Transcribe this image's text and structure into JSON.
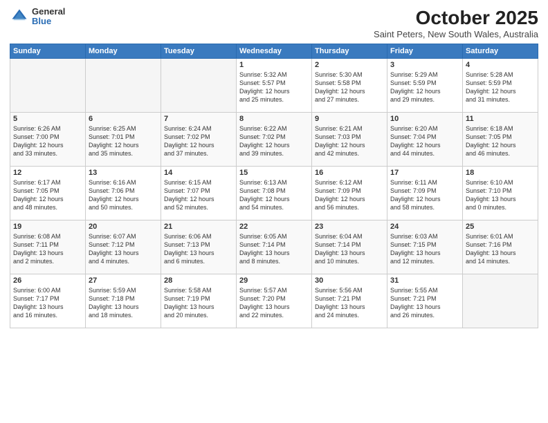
{
  "logo": {
    "general": "General",
    "blue": "Blue"
  },
  "header": {
    "month": "October 2025",
    "location": "Saint Peters, New South Wales, Australia"
  },
  "days_of_week": [
    "Sunday",
    "Monday",
    "Tuesday",
    "Wednesday",
    "Thursday",
    "Friday",
    "Saturday"
  ],
  "weeks": [
    [
      {
        "day": "",
        "content": ""
      },
      {
        "day": "",
        "content": ""
      },
      {
        "day": "",
        "content": ""
      },
      {
        "day": "1",
        "content": "Sunrise: 5:32 AM\nSunset: 5:57 PM\nDaylight: 12 hours\nand 25 minutes."
      },
      {
        "day": "2",
        "content": "Sunrise: 5:30 AM\nSunset: 5:58 PM\nDaylight: 12 hours\nand 27 minutes."
      },
      {
        "day": "3",
        "content": "Sunrise: 5:29 AM\nSunset: 5:59 PM\nDaylight: 12 hours\nand 29 minutes."
      },
      {
        "day": "4",
        "content": "Sunrise: 5:28 AM\nSunset: 5:59 PM\nDaylight: 12 hours\nand 31 minutes."
      }
    ],
    [
      {
        "day": "5",
        "content": "Sunrise: 6:26 AM\nSunset: 7:00 PM\nDaylight: 12 hours\nand 33 minutes."
      },
      {
        "day": "6",
        "content": "Sunrise: 6:25 AM\nSunset: 7:01 PM\nDaylight: 12 hours\nand 35 minutes."
      },
      {
        "day": "7",
        "content": "Sunrise: 6:24 AM\nSunset: 7:02 PM\nDaylight: 12 hours\nand 37 minutes."
      },
      {
        "day": "8",
        "content": "Sunrise: 6:22 AM\nSunset: 7:02 PM\nDaylight: 12 hours\nand 39 minutes."
      },
      {
        "day": "9",
        "content": "Sunrise: 6:21 AM\nSunset: 7:03 PM\nDaylight: 12 hours\nand 42 minutes."
      },
      {
        "day": "10",
        "content": "Sunrise: 6:20 AM\nSunset: 7:04 PM\nDaylight: 12 hours\nand 44 minutes."
      },
      {
        "day": "11",
        "content": "Sunrise: 6:18 AM\nSunset: 7:05 PM\nDaylight: 12 hours\nand 46 minutes."
      }
    ],
    [
      {
        "day": "12",
        "content": "Sunrise: 6:17 AM\nSunset: 7:05 PM\nDaylight: 12 hours\nand 48 minutes."
      },
      {
        "day": "13",
        "content": "Sunrise: 6:16 AM\nSunset: 7:06 PM\nDaylight: 12 hours\nand 50 minutes."
      },
      {
        "day": "14",
        "content": "Sunrise: 6:15 AM\nSunset: 7:07 PM\nDaylight: 12 hours\nand 52 minutes."
      },
      {
        "day": "15",
        "content": "Sunrise: 6:13 AM\nSunset: 7:08 PM\nDaylight: 12 hours\nand 54 minutes."
      },
      {
        "day": "16",
        "content": "Sunrise: 6:12 AM\nSunset: 7:09 PM\nDaylight: 12 hours\nand 56 minutes."
      },
      {
        "day": "17",
        "content": "Sunrise: 6:11 AM\nSunset: 7:09 PM\nDaylight: 12 hours\nand 58 minutes."
      },
      {
        "day": "18",
        "content": "Sunrise: 6:10 AM\nSunset: 7:10 PM\nDaylight: 13 hours\nand 0 minutes."
      }
    ],
    [
      {
        "day": "19",
        "content": "Sunrise: 6:08 AM\nSunset: 7:11 PM\nDaylight: 13 hours\nand 2 minutes."
      },
      {
        "day": "20",
        "content": "Sunrise: 6:07 AM\nSunset: 7:12 PM\nDaylight: 13 hours\nand 4 minutes."
      },
      {
        "day": "21",
        "content": "Sunrise: 6:06 AM\nSunset: 7:13 PM\nDaylight: 13 hours\nand 6 minutes."
      },
      {
        "day": "22",
        "content": "Sunrise: 6:05 AM\nSunset: 7:14 PM\nDaylight: 13 hours\nand 8 minutes."
      },
      {
        "day": "23",
        "content": "Sunrise: 6:04 AM\nSunset: 7:14 PM\nDaylight: 13 hours\nand 10 minutes."
      },
      {
        "day": "24",
        "content": "Sunrise: 6:03 AM\nSunset: 7:15 PM\nDaylight: 13 hours\nand 12 minutes."
      },
      {
        "day": "25",
        "content": "Sunrise: 6:01 AM\nSunset: 7:16 PM\nDaylight: 13 hours\nand 14 minutes."
      }
    ],
    [
      {
        "day": "26",
        "content": "Sunrise: 6:00 AM\nSunset: 7:17 PM\nDaylight: 13 hours\nand 16 minutes."
      },
      {
        "day": "27",
        "content": "Sunrise: 5:59 AM\nSunset: 7:18 PM\nDaylight: 13 hours\nand 18 minutes."
      },
      {
        "day": "28",
        "content": "Sunrise: 5:58 AM\nSunset: 7:19 PM\nDaylight: 13 hours\nand 20 minutes."
      },
      {
        "day": "29",
        "content": "Sunrise: 5:57 AM\nSunset: 7:20 PM\nDaylight: 13 hours\nand 22 minutes."
      },
      {
        "day": "30",
        "content": "Sunrise: 5:56 AM\nSunset: 7:21 PM\nDaylight: 13 hours\nand 24 minutes."
      },
      {
        "day": "31",
        "content": "Sunrise: 5:55 AM\nSunset: 7:21 PM\nDaylight: 13 hours\nand 26 minutes."
      },
      {
        "day": "",
        "content": ""
      }
    ]
  ]
}
